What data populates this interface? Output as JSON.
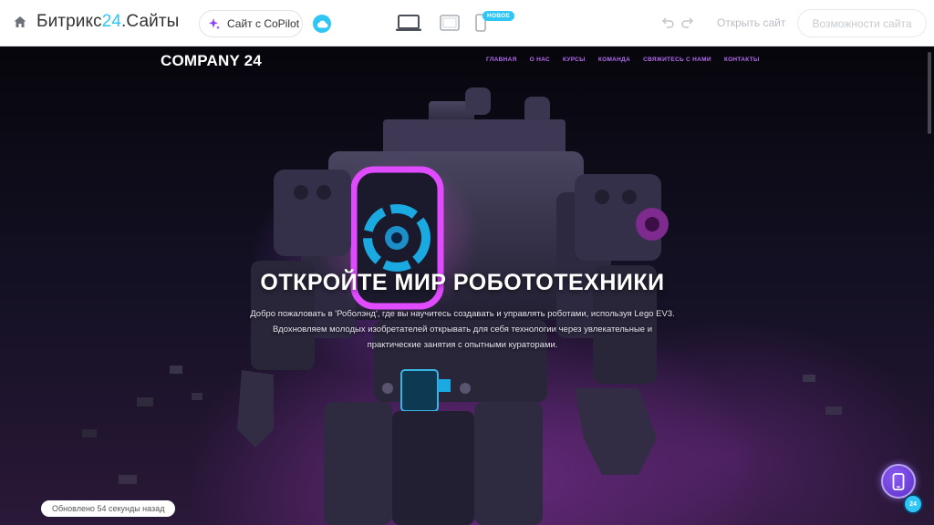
{
  "topbar": {
    "brand_prefix": "Битрикс",
    "brand_accent": "24",
    "brand_suffix": ".Сайты",
    "copilot_label": "Сайт с CoPilot",
    "new_badge": "НОВОЕ",
    "open_site_label": "Открыть сайт",
    "features_label": "Возможности сайта",
    "accent_color": "#2fc6f6"
  },
  "site": {
    "logo": "COMPANY 24",
    "nav": [
      "ГЛАВНАЯ",
      "О НАС",
      "КУРСЫ",
      "КОМАНДА",
      "СВЯЖИТЕСЬ С НАМИ",
      "КОНТАКТЫ"
    ],
    "nav_color": "#b46cf0",
    "hero_title": "ОТКРОЙТЕ МИР РОБОТОТЕХНИКИ",
    "hero_text": "Добро пожаловать в 'Роболэнд', где вы научитесь создавать и управлять роботами, используя Lego EV3. Вдохновляем молодых изобретателей открывать для себя технологии через увлекательные и практические занятия с опытными кураторами."
  },
  "status": {
    "updated_text": "Обновлено 54 секунды назад",
    "badge_text": "24"
  }
}
